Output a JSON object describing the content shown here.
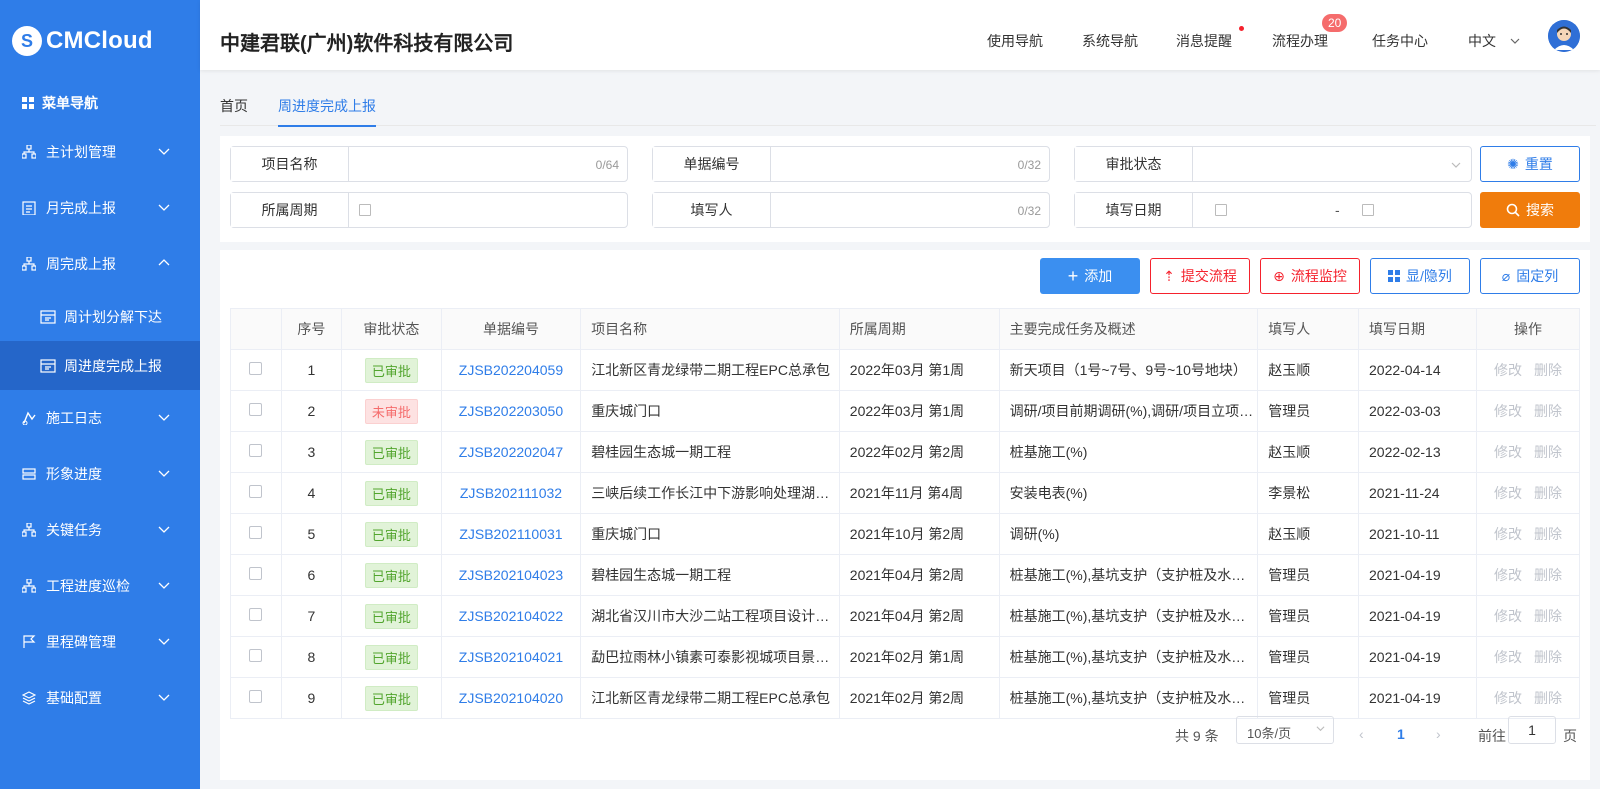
{
  "brand": {
    "logo_text": "CMCloud",
    "logo_mark": "S",
    "company": "中建君联(广州)软件科技有限公司"
  },
  "sidebar": {
    "title": "菜单导航",
    "items": [
      {
        "label": "主计划管理",
        "icon": "org-icon",
        "expanded": false
      },
      {
        "label": "月完成上报",
        "icon": "clipboard-icon",
        "expanded": false
      },
      {
        "label": "周完成上报",
        "icon": "org-icon",
        "expanded": true
      },
      {
        "label": "施工日志",
        "icon": "log-icon",
        "expanded": false
      },
      {
        "label": "形象进度",
        "icon": "db-icon",
        "expanded": false
      },
      {
        "label": "关键任务",
        "icon": "org-icon",
        "expanded": false
      },
      {
        "label": "工程进度巡检",
        "icon": "org-icon",
        "expanded": false
      },
      {
        "label": "里程碑管理",
        "icon": "flag-icon",
        "expanded": false
      },
      {
        "label": "基础配置",
        "icon": "layers-icon",
        "expanded": false
      }
    ],
    "subitems": [
      {
        "label": "周计划分解下达",
        "active": false
      },
      {
        "label": "周进度完成上报",
        "active": true
      }
    ]
  },
  "header": {
    "nav": [
      "使用导航",
      "系统导航",
      "消息提醒",
      "流程办理",
      "任务中心"
    ],
    "process_badge": "20",
    "language": "中文"
  },
  "tabs": [
    {
      "label": "首页",
      "active": false
    },
    {
      "label": "周进度完成上报",
      "active": true
    }
  ],
  "filters": {
    "project_name": {
      "label": "项目名称",
      "count": "0/64"
    },
    "doc_no": {
      "label": "单据编号",
      "count": "0/32"
    },
    "approval": {
      "label": "审批状态"
    },
    "period": {
      "label": "所属周期"
    },
    "filler": {
      "label": "填写人",
      "count": "0/32"
    },
    "fill_date": {
      "label": "填写日期",
      "sep": "-"
    },
    "reset_label": "重置",
    "search_label": "搜索"
  },
  "toolbar": {
    "add": "添加",
    "submit": "提交流程",
    "monitor": "流程监控",
    "toggle_cols": "显/隐列",
    "fix_cols": "固定列"
  },
  "table": {
    "headers": [
      "序号",
      "审批状态",
      "单据编号",
      "项目名称",
      "所属周期",
      "主要完成任务及概述",
      "填写人",
      "填写日期",
      "操作"
    ],
    "edit_label": "修改",
    "delete_label": "删除",
    "rows": [
      {
        "no": "1",
        "status": "已审批",
        "ok": true,
        "code": "ZJSB202204059",
        "project": "江北新区青龙绿带二期工程EPC总承包",
        "period": "2022年03月 第1周",
        "task": "新天项目（1号~7号、9号~10号地块）",
        "user": "赵玉顺",
        "date": "2022-04-14"
      },
      {
        "no": "2",
        "status": "未审批",
        "ok": false,
        "code": "ZJSB202203050",
        "project": "重庆城门口",
        "period": "2022年03月 第1周",
        "task": "调研/项目前期调研(%),调研/项目立项(%)",
        "user": "管理员",
        "date": "2022-03-03"
      },
      {
        "no": "3",
        "status": "已审批",
        "ok": true,
        "code": "ZJSB202202047",
        "project": "碧桂园生态城一期工程",
        "period": "2022年02月 第2周",
        "task": "桩基施工(%)",
        "user": "赵玉顺",
        "date": "2022-02-13"
      },
      {
        "no": "4",
        "status": "已审批",
        "ok": true,
        "code": "ZJSB202111032",
        "project": "三峡后续工作长江中下游影响处理湖北段",
        "period": "2021年11月 第4周",
        "task": "安装电表(%)",
        "user": "李景松",
        "date": "2021-11-24"
      },
      {
        "no": "5",
        "status": "已审批",
        "ok": true,
        "code": "ZJSB202110031",
        "project": "重庆城门口",
        "period": "2021年10月 第2周",
        "task": "调研(%)",
        "user": "赵玉顺",
        "date": "2021-10-11"
      },
      {
        "no": "6",
        "status": "已审批",
        "ok": true,
        "code": "ZJSB202104023",
        "project": "碧桂园生态城一期工程",
        "period": "2021年04月 第2周",
        "task": "桩基施工(%),基坑支护（支护桩及水泥搅拌桩）",
        "user": "管理员",
        "date": "2021-04-19"
      },
      {
        "no": "7",
        "status": "已审批",
        "ok": true,
        "code": "ZJSB202104022",
        "project": "湖北省汉川市大沙二站工程项目设计施工总承包",
        "period": "2021年04月 第2周",
        "task": "桩基施工(%),基坑支护（支护桩及水泥搅拌桩）",
        "user": "管理员",
        "date": "2021-04-19"
      },
      {
        "no": "8",
        "status": "已审批",
        "ok": true,
        "code": "ZJSB202104021",
        "project": "勐巴拉雨林小镇素可泰影视城项目景观工程",
        "period": "2021年02月 第1周",
        "task": "桩基施工(%),基坑支护（支护桩及水泥搅拌桩）",
        "user": "管理员",
        "date": "2021-04-19"
      },
      {
        "no": "9",
        "status": "已审批",
        "ok": true,
        "code": "ZJSB202104020",
        "project": "江北新区青龙绿带二期工程EPC总承包",
        "period": "2021年02月 第2周",
        "task": "桩基施工(%),基坑支护（支护桩及水泥搅拌桩）",
        "user": "管理员",
        "date": "2021-04-19"
      }
    ]
  },
  "pagination": {
    "total": "共 9 条",
    "page_size": "10条/页",
    "current": "1",
    "goto_label": "前往",
    "goto_value": "1",
    "page_suffix": "页"
  },
  "colors": {
    "primary": "#2f7de8",
    "danger": "#f5222d",
    "warning": "#f07c0c",
    "success": "#52a52e"
  }
}
